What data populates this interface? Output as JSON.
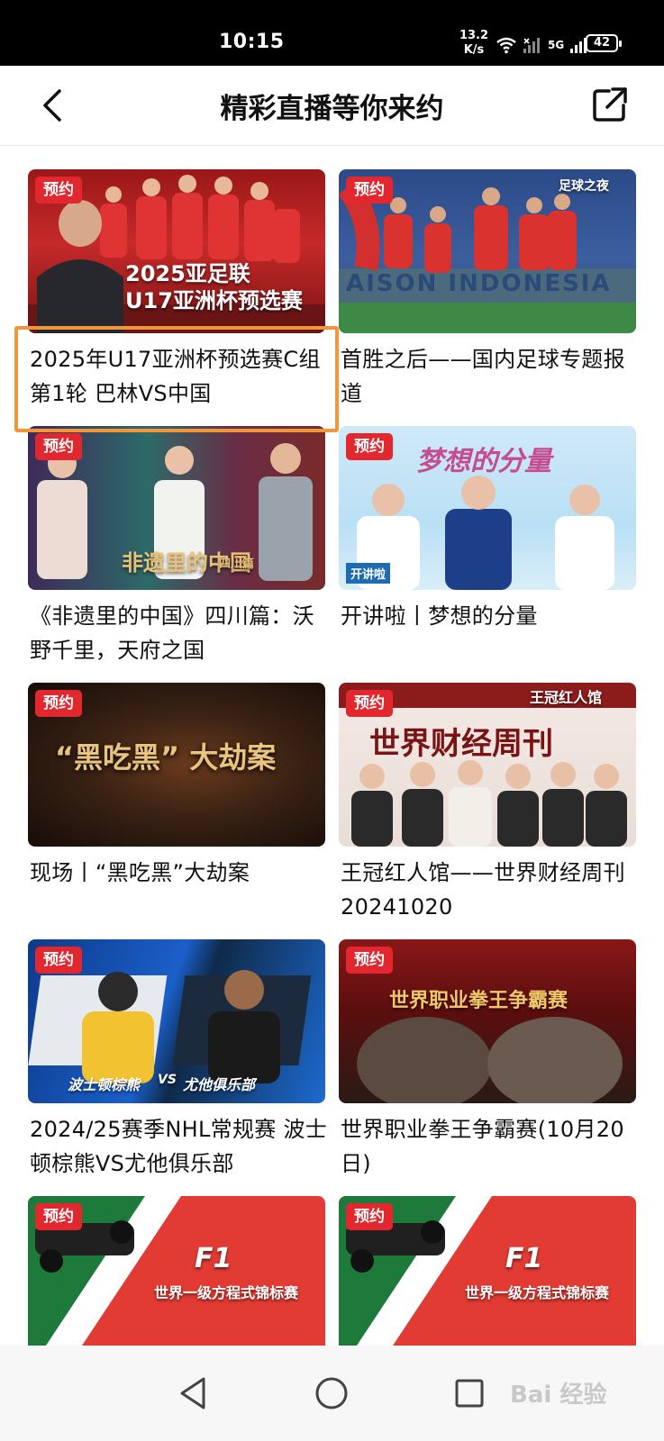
{
  "status_bar": {
    "time": "10:15",
    "net_speed_value": "13.2",
    "net_speed_unit": "K/s",
    "battery": "42",
    "network_label": "5G"
  },
  "header": {
    "title": "精彩直播等你来约",
    "back_icon": "chevron-left-icon",
    "share_icon": "share-external-icon"
  },
  "badge_label": "预约",
  "cards": [
    {
      "title": "2025年U17亚洲杯预选赛C组第1轮 巴林VS中国",
      "thumb_text_1": "2025亚足联",
      "thumb_text_2": "U17亚洲杯预选赛",
      "highlighted": true
    },
    {
      "title": "首胜之后——国内足球专题报道",
      "thumb_text_1": "足球之夜",
      "thumb_text_2": "AISON INDONESIA"
    },
    {
      "title": "《非遗里的中国》四川篇：沃野千里，天府之国",
      "thumb_text_1": "非遗里的中国",
      "thumb_text_2": "四川篇"
    },
    {
      "title": "开讲啦丨梦想的分量",
      "thumb_text_1": "梦想的分量",
      "thumb_text_2": "开讲啦"
    },
    {
      "title": "现场丨“黑吃黑”大劫案",
      "thumb_text_1": "“黑吃黑” 大劫案"
    },
    {
      "title": "王冠红人馆——世界财经周刊20241020",
      "thumb_text_1": "王冠红人馆",
      "thumb_text_2": "世界财经周刊"
    },
    {
      "title": "2024/25赛季NHL常规赛 波士顿棕熊VS尤他俱乐部",
      "thumb_text_1": "波士顿棕熊",
      "thumb_text_2": "VS",
      "thumb_text_3": "尤他俱乐部"
    },
    {
      "title": "世界职业拳王争霸赛(10月20日)",
      "thumb_text_1": "世界职业拳王争霸赛"
    },
    {
      "title": "",
      "thumb_text_1": "F1",
      "thumb_text_2": "世界一级方程式锦标赛"
    },
    {
      "title": "",
      "thumb_text_1": "F1",
      "thumb_text_2": "世界一级方程式锦标赛"
    }
  ],
  "nav": {
    "back": "triangle-back-icon",
    "home": "circle-home-icon",
    "recent": "square-recent-icon"
  },
  "watermark": "Bai 经验"
}
